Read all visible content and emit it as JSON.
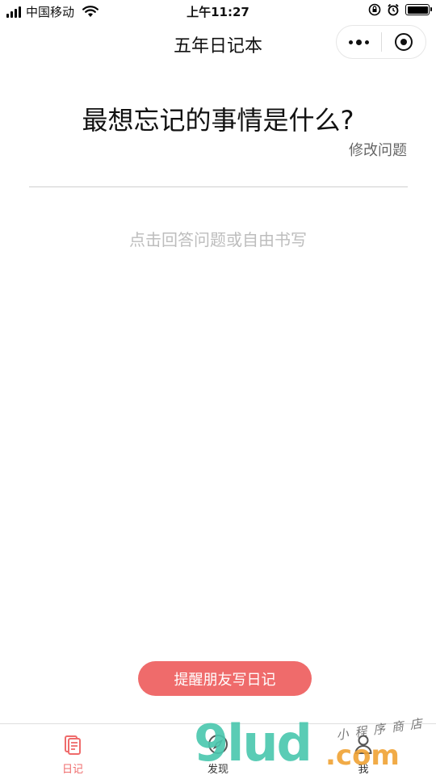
{
  "status_bar": {
    "carrier": "中国移动",
    "time": "上午11:27"
  },
  "nav": {
    "title": "五年日记本"
  },
  "question": {
    "text": "最想忘记的事情是什么?",
    "edit_label": "修改问题"
  },
  "answer": {
    "placeholder": "点击回答问题或自由书写"
  },
  "remind_button": {
    "label": "提醒朋友写日记"
  },
  "tabs": [
    {
      "label": "日记",
      "icon": "diary-icon",
      "active": true
    },
    {
      "label": "发现",
      "icon": "compass-icon",
      "active": false
    },
    {
      "label": "我",
      "icon": "user-icon",
      "active": false
    }
  ],
  "watermark": {
    "brand": "9lud",
    "suffix": ".com",
    "tagline": "小程序商店"
  },
  "colors": {
    "accent": "#ef6b6b",
    "placeholder": "#bdbdbd",
    "secondary_text": "#666666"
  }
}
